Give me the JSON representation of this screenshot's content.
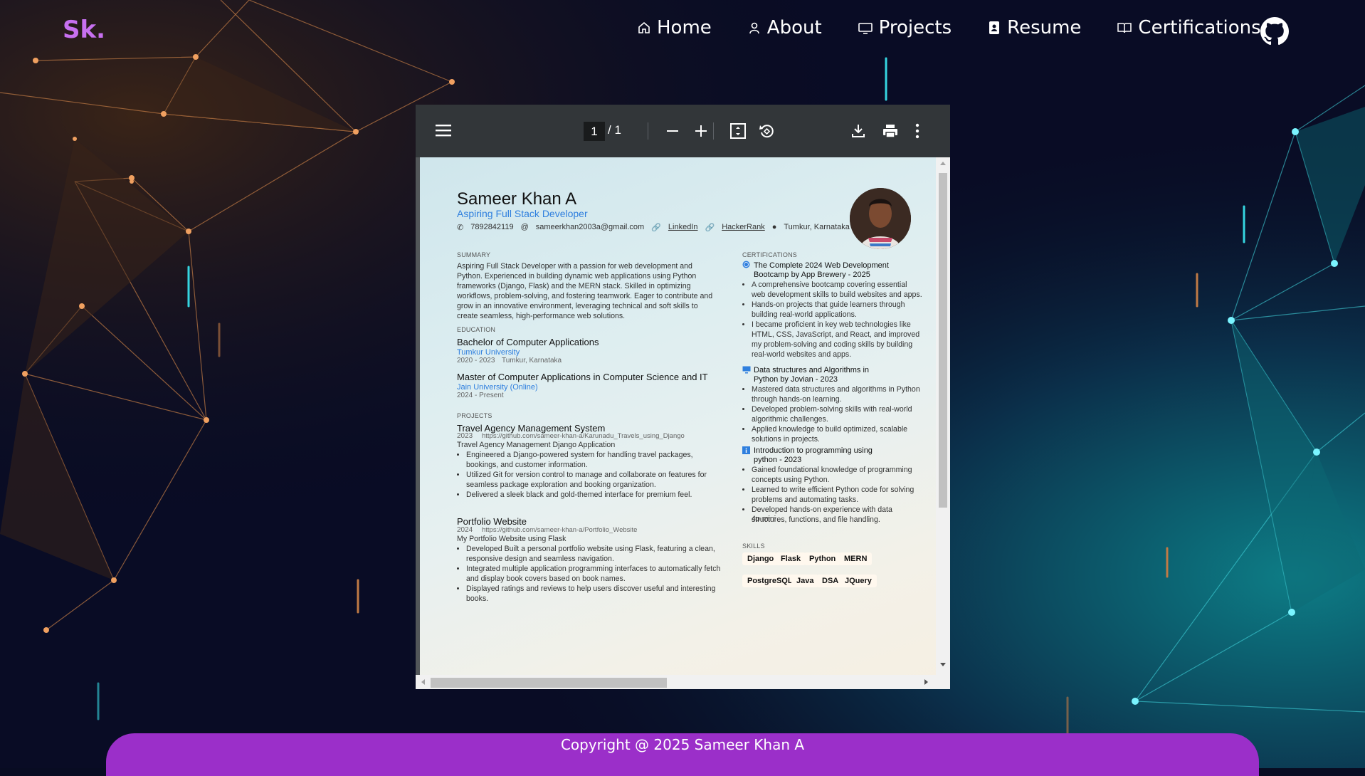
{
  "brand": {
    "logo": "Sk."
  },
  "nav": {
    "home": "Home",
    "about": "About",
    "projects": "Projects",
    "resume": "Resume",
    "certifications": "Certifications"
  },
  "viewer": {
    "current_page": "1",
    "page_total": "/  1"
  },
  "resume": {
    "name": "Sameer Khan A",
    "role": "Aspiring Full Stack Developer",
    "phone": "7892842119",
    "email": "sameerkhan2003a@gmail.com",
    "linkedin": "LinkedIn",
    "hackerrank": "HackerRank",
    "location": "Tumkur, Karnataka",
    "summary_heading": "SUMMARY",
    "summary": "Aspiring Full Stack Developer with a passion for web development and Python. Experienced in building dynamic web applications using Python frameworks (Django, Flask) and the MERN stack. Skilled in optimizing workflows, problem-solving, and fostering teamwork. Eager to contribute and grow in an innovative environment, leveraging technical and soft skills to create seamless, high-performance web solutions.",
    "education_heading": "EDUCATION",
    "edu1_degree": "Bachelor of Computer Applications",
    "edu1_school": "Tumkur University",
    "edu1_years": "2020 - 2023",
    "edu1_place": "Tumkur, Karnataka",
    "edu2_degree": "Master of Computer Applications in Computer Science and IT",
    "edu2_school": "Jain University (Online)",
    "edu2_years": "2024 - Present",
    "projects_heading": "PROJECTS",
    "p1_title": "Travel Agency Management System",
    "p1_year": "2023",
    "p1_url": "https://github.com/sameer-khan-a/Karunadu_Travels_using_Django",
    "p1_sub": "Travel Agency Management Django Application",
    "p1_b1": "Engineered a Django-powered system for handling travel packages, bookings, and customer information.",
    "p1_b2": "Utilized Git for version control to manage and collaborate on features for seamless package exploration and booking organization.",
    "p1_b3": "Delivered a sleek black and gold-themed interface for premium feel.",
    "p2_title": "Portfolio Website",
    "p2_year": "2024",
    "p2_url": "https://github.com/sameer-khan-a/Portfolio_Website",
    "p2_sub": "My Portfolio Website using Flask",
    "p2_b1": "Developed Built a personal portfolio website using Flask, featuring a clean, responsive design and seamless navigation.",
    "p2_b2": "Integrated multiple application programming interfaces to automatically fetch and display book covers based on book names.",
    "p2_b3": "Displayed ratings and reviews to help users discover useful and interesting books.",
    "cert_heading": "CERTIFICATIONS",
    "c1_title": "The Complete 2024 Web Development Bootcamp by App Brewery - 2025",
    "c1_b1": "A comprehensive bootcamp covering essential web development skills to build websites and apps.",
    "c1_b2": "Hands-on projects that guide learners through building real-world applications.",
    "c1_b3": "I became proficient in key web technologies like HTML, CSS, JavaScript, and React, and improved my problem-solving and coding skills by building real-world websites and apps.",
    "c2_title": "Data structures and Algorithms in Python by Jovian - 2023",
    "c2_b1": "Mastered data structures and algorithms in Python through hands-on learning.",
    "c2_b2": "Developed problem-solving skills with real-world algorithmic challenges.",
    "c2_b3": "Applied knowledge to build optimized, scalable solutions in projects.",
    "c3_title": "Introduction to programming using python - 2023",
    "c3_b1": "Gained foundational knowledge of programming concepts using Python.",
    "c3_b2": "Learned to write efficient Python code for solving problems and automating tasks.",
    "c3_b3": "Developed hands-on experience with data structures, functions, and file handling.",
    "c3_extra": "4o mini",
    "skills_heading": "SKILLS",
    "skills": [
      "Django",
      "Flask",
      "Python",
      "MERN",
      "PostgreSQL",
      "Java",
      "DSA",
      "JQuery"
    ]
  },
  "footer": {
    "copyright": "Copyright @ 2025 Sameer Khan A"
  },
  "colors": {
    "accent": "#c770f0",
    "footer": "#9b2fc9",
    "link": "#2f7fde"
  }
}
